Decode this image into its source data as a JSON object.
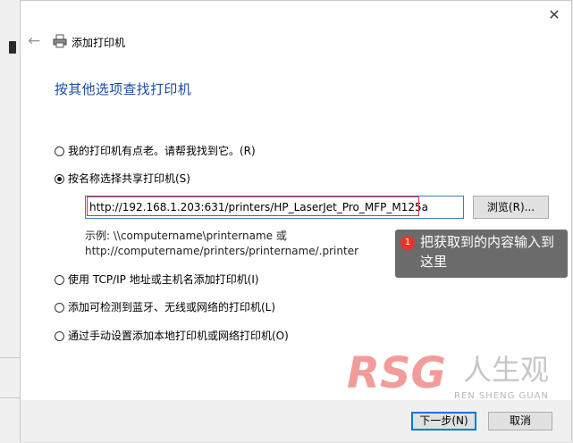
{
  "window": {
    "title": "添加打印机",
    "close_glyph": "✕",
    "back_glyph": "←"
  },
  "heading": "按其他选项查找打印机",
  "options": [
    {
      "label": "我的打印机有点老。请帮我找到它。(R)",
      "checked": false
    },
    {
      "label": "按名称选择共享打印机(S)",
      "checked": true
    },
    {
      "label": "使用 TCP/IP 地址或主机名添加打印机(I)",
      "checked": false
    },
    {
      "label": "添加可检测到蓝牙、无线或网络的打印机(L)",
      "checked": false
    },
    {
      "label": "通过手动设置添加本地打印机或网络打印机(O)",
      "checked": false
    }
  ],
  "shared_printer": {
    "value": "http://192.168.1.203:631/printers/HP_LaserJet_Pro_MFP_M125a",
    "browse_label": "浏览(R)...",
    "example_line1": "示例: \\\\computername\\printername 或",
    "example_line2": "http://computername/printers/printername/.printer"
  },
  "annotation": {
    "number": "1",
    "text": "把获取到的内容输入到这里"
  },
  "watermark": {
    "logo": "RSG",
    "name": "人生观",
    "sub": "REN SHENG GUAN"
  },
  "footer": {
    "next_label": "下一步(N)",
    "cancel_label": "取消"
  },
  "colors": {
    "heading": "#1c4a9c",
    "highlight_box": "#e03030",
    "badge": "#e8332a",
    "tooltip_bg": "#6b6b6b",
    "focus": "#0078d7"
  }
}
